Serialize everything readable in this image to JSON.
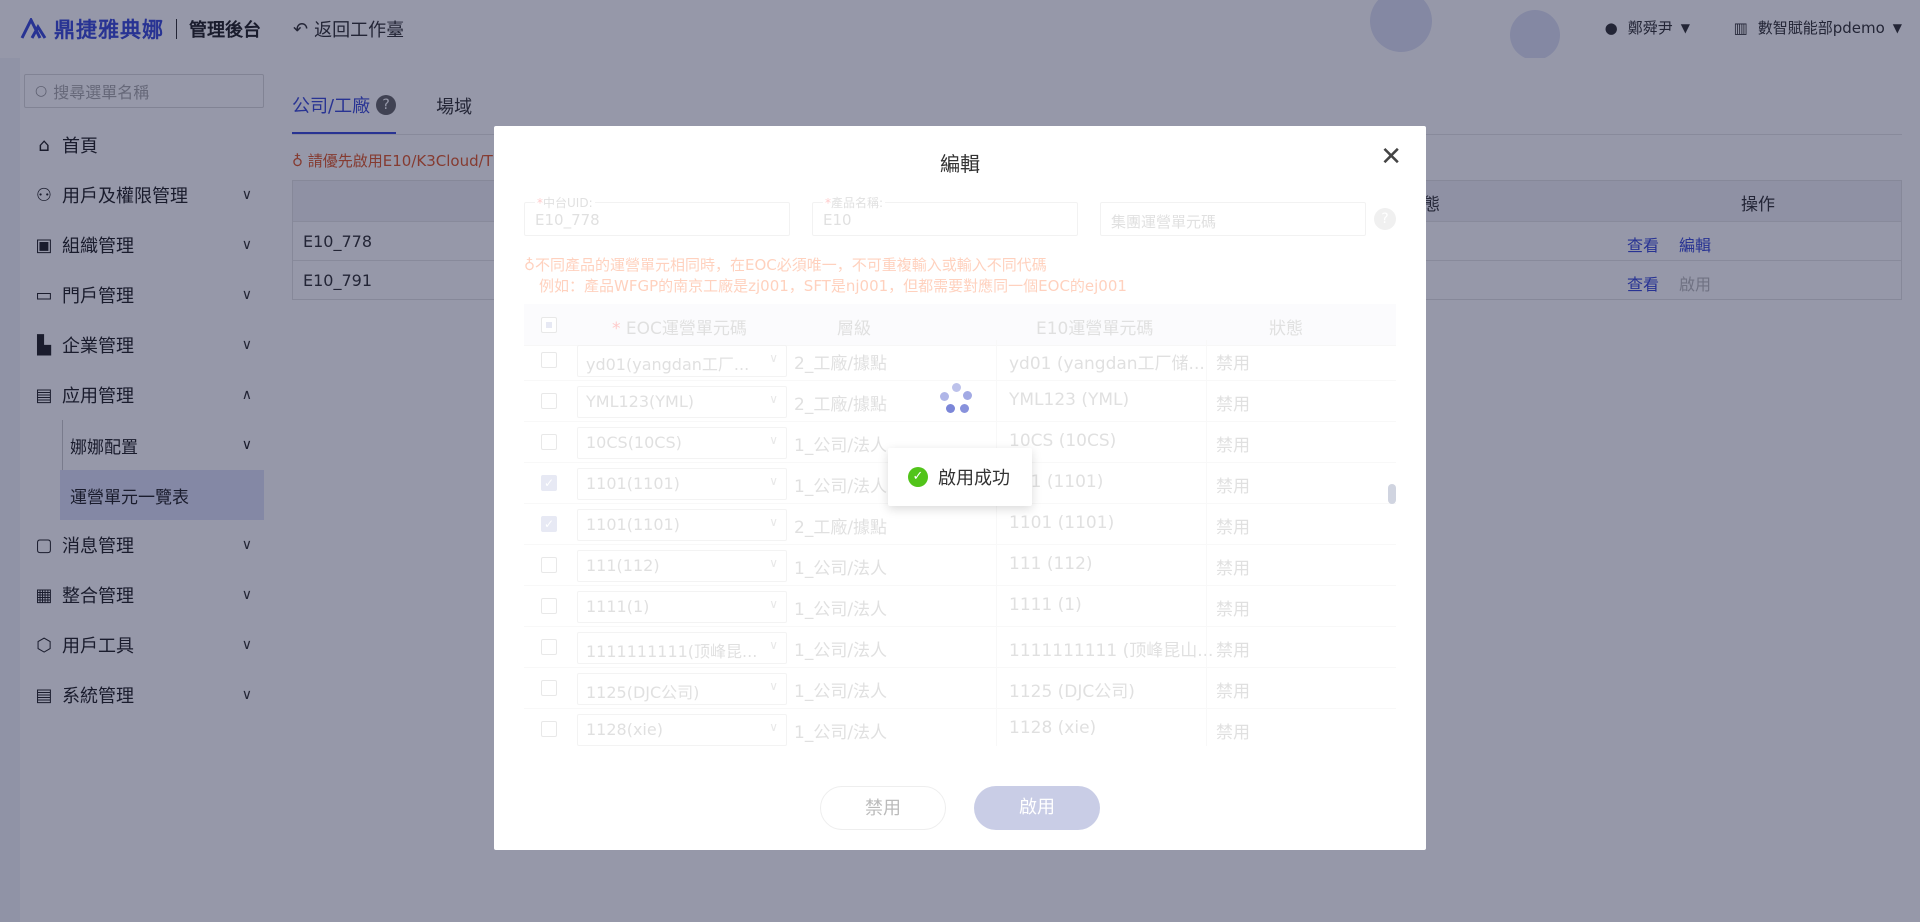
{
  "header": {
    "brand": "鼎捷雅典娜",
    "admin_title": "管理後台",
    "back_label": "返回工作臺",
    "user_name": "鄭舜尹",
    "org_name": "數智賦能部pdemo"
  },
  "sidebar": {
    "search_placeholder": "搜尋選單名稱",
    "items": [
      {
        "label": "首頁",
        "icon": "home-icon"
      },
      {
        "label": "用戶及權限管理",
        "icon": "users-icon"
      },
      {
        "label": "組織管理",
        "icon": "org-icon"
      },
      {
        "label": "門戶管理",
        "icon": "portal-icon"
      },
      {
        "label": "企業管理",
        "icon": "enterprise-icon"
      },
      {
        "label": "应用管理",
        "icon": "app-icon"
      },
      {
        "label": "消息管理",
        "icon": "message-icon"
      },
      {
        "label": "整合管理",
        "icon": "integration-icon"
      },
      {
        "label": "用戶工具",
        "icon": "tool-icon"
      },
      {
        "label": "系統管理",
        "icon": "system-icon"
      }
    ],
    "sub_items": [
      {
        "label": "娜娜配置"
      },
      {
        "label": "運營單元一覽表"
      }
    ]
  },
  "main": {
    "tabs": [
      {
        "label": "公司/工廠"
      },
      {
        "label": "場域"
      }
    ],
    "warning": "請優先啟用E10/K3Cloud/T",
    "table_headers": {
      "status": "態",
      "action": "操作"
    },
    "rows": [
      {
        "code": "E10_778",
        "view": "查看",
        "edit": "編輯"
      },
      {
        "code": "E10_791",
        "view": "查看",
        "enable": "啟用"
      }
    ]
  },
  "modal": {
    "title": "編輯",
    "fields": {
      "uid_label": "中台UID:",
      "uid_value": "E10_778",
      "product_label": "產品名稱:",
      "product_value": "E10",
      "group_placeholder": "集團運營單元碼"
    },
    "warning_line1": "不同產品的運營單元相同時，在EOC必須唯一，不可重複輸入或輸入不同代碼",
    "warning_line2": "例如：產品WFGP的南京工廠是zj001，SFT是nj001，但都需要對應同一個EOC的ej001",
    "columns": {
      "eoc": "EOC運營單元碼",
      "level": "層級",
      "e10": "E10運營單元碼",
      "status": "狀態"
    },
    "rows": [
      {
        "eoc": "yd01(yangdan工厂...",
        "level": "2_工廠/據點",
        "e10": "yd01 (yangdan工厂储...",
        "status": "禁用",
        "checked": false
      },
      {
        "eoc": "YML123(YML)",
        "level": "2_工廠/據點",
        "e10": "YML123 (YML)",
        "status": "禁用",
        "checked": false
      },
      {
        "eoc": "10CS(10CS)",
        "level": "1_公司/法人",
        "e10": "10CS (10CS)",
        "status": "禁用",
        "checked": false
      },
      {
        "eoc": "1101(1101)",
        "level": "1_公司/法人",
        "e10": "101 (1101)",
        "status": "禁用",
        "checked": true
      },
      {
        "eoc": "1101(1101)",
        "level": "2_工廠/據點",
        "e10": "1101 (1101)",
        "status": "禁用",
        "checked": true
      },
      {
        "eoc": "111(112)",
        "level": "1_公司/法人",
        "e10": "111 (112)",
        "status": "禁用",
        "checked": false
      },
      {
        "eoc": "1111(1)",
        "level": "1_公司/法人",
        "e10": "1111 (1)",
        "status": "禁用",
        "checked": false
      },
      {
        "eoc": "1111111111(顶峰昆...",
        "level": "1_公司/法人",
        "e10": "1111111111 (顶峰昆山...",
        "status": "禁用",
        "checked": false
      },
      {
        "eoc": "1125(DJC公司)",
        "level": "1_公司/法人",
        "e10": "1125 (DJC公司)",
        "status": "禁用",
        "checked": false
      },
      {
        "eoc": "1128(xie)",
        "level": "1_公司/法人",
        "e10": "1128 (xie)",
        "status": "禁用",
        "checked": false
      }
    ],
    "btn_disable": "禁用",
    "btn_enable": "啟用"
  },
  "toast": {
    "message": "啟用成功"
  },
  "colors": {
    "accent": "#3b4bd8",
    "warning": "#e05a2a",
    "success": "#52c41a"
  }
}
